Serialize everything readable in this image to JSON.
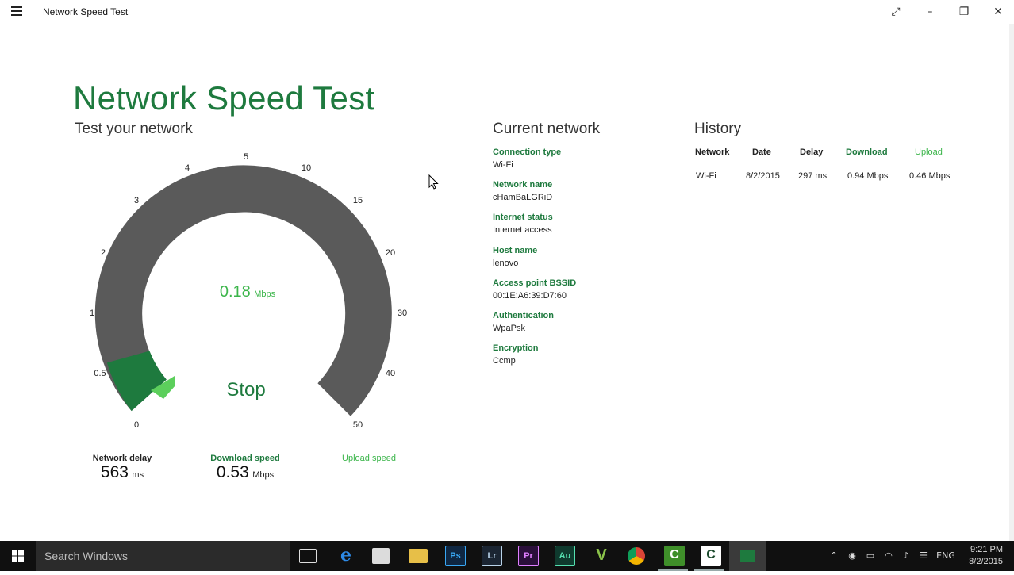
{
  "window": {
    "title": "Network Speed Test",
    "menu_icon": "hamburger-icon",
    "buttons": [
      "expand-icon",
      "minimize-icon",
      "restore-icon",
      "close-icon"
    ]
  },
  "app": {
    "title": "Network Speed Test",
    "subtitle": "Test your network",
    "accent_color": "#1e7a3e",
    "light_accent_color": "#3bb54a"
  },
  "gauge": {
    "scale_labels": [
      "0",
      "0.5",
      "1",
      "2",
      "3",
      "4",
      "5",
      "10",
      "15",
      "20",
      "30",
      "40",
      "50"
    ],
    "current_value": "0.18",
    "current_unit": "Mbps",
    "stop_label": "Stop"
  },
  "metrics": {
    "delay": {
      "label": "Network delay",
      "value": "563",
      "unit": "ms"
    },
    "download": {
      "label": "Download speed",
      "value": "0.53",
      "unit": "Mbps"
    },
    "upload": {
      "label": "Upload speed"
    }
  },
  "current_network": {
    "title": "Current network",
    "items": [
      {
        "label": "Connection type",
        "value": "Wi-Fi"
      },
      {
        "label": "Network name",
        "value": "cHamBaLGRiD"
      },
      {
        "label": "Internet status",
        "value": "Internet access"
      },
      {
        "label": "Host name",
        "value": "lenovo"
      },
      {
        "label": "Access point BSSID",
        "value": "00:1E:A6:39:D7:60"
      },
      {
        "label": "Authentication",
        "value": "WpaPsk"
      },
      {
        "label": "Encryption",
        "value": "Ccmp"
      }
    ]
  },
  "history": {
    "title": "History",
    "columns": [
      "Network",
      "Date",
      "Delay",
      "Download",
      "Upload"
    ],
    "rows": [
      [
        "Wi-Fi",
        "8/2/2015",
        "297 ms",
        "0.94 Mbps",
        "0.46 Mbps"
      ]
    ]
  },
  "taskbar": {
    "search_placeholder": "Search Windows",
    "apps": [
      {
        "name": "task-view-icon",
        "label": ""
      },
      {
        "name": "edge-icon",
        "label": "e"
      },
      {
        "name": "store-icon",
        "label": ""
      },
      {
        "name": "file-explorer-icon",
        "label": ""
      },
      {
        "name": "photoshop-icon",
        "label": "Ps"
      },
      {
        "name": "lightroom-icon",
        "label": "Lr"
      },
      {
        "name": "premiere-icon",
        "label": "Pr"
      },
      {
        "name": "audition-icon",
        "label": "Au"
      },
      {
        "name": "vectorize-icon",
        "label": "V"
      },
      {
        "name": "chrome-icon",
        "label": ""
      },
      {
        "name": "camtasia-icon",
        "label": "C"
      },
      {
        "name": "camtasia-recorder-icon",
        "label": "C"
      },
      {
        "name": "speed-test-icon",
        "label": ""
      }
    ],
    "language": "ENG",
    "time": "9:21 PM",
    "date": "8/2/2015"
  }
}
